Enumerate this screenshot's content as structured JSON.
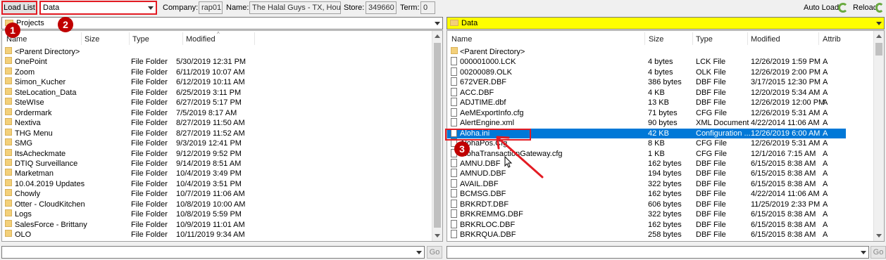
{
  "toolbar": {
    "load_list": "Load List",
    "list_select": "Data",
    "company_label": "Company:",
    "company_value": "rap01",
    "name_label": "Name:",
    "name_value": "The Halal Guys - TX, Housto",
    "store_label": "Store:",
    "store_value": "349660",
    "term_label": "Term:",
    "term_value": "0",
    "auto_load": "Auto Load",
    "reload": "Reload"
  },
  "left": {
    "path": "Projects",
    "columns": {
      "name": "Name",
      "size": "Size",
      "type": "Type",
      "modified": "Modified"
    },
    "rows": [
      {
        "name": "<Parent Directory>",
        "size": "",
        "type": "",
        "modified": ""
      },
      {
        "name": "OnePoint",
        "size": "",
        "type": "File Folder",
        "modified": "5/30/2019 12:31 PM"
      },
      {
        "name": "Zoom",
        "size": "",
        "type": "File Folder",
        "modified": "6/11/2019 10:07 AM"
      },
      {
        "name": "Simon_Kucher",
        "size": "",
        "type": "File Folder",
        "modified": "6/12/2019 10:11 AM"
      },
      {
        "name": "SteLocation_Data",
        "size": "",
        "type": "File Folder",
        "modified": "6/25/2019 3:11 PM"
      },
      {
        "name": "SteWIse",
        "size": "",
        "type": "File Folder",
        "modified": "6/27/2019 5:17 PM"
      },
      {
        "name": "Ordermark",
        "size": "",
        "type": "File Folder",
        "modified": "7/5/2019 8:17 AM"
      },
      {
        "name": "Nextiva",
        "size": "",
        "type": "File Folder",
        "modified": "8/27/2019 11:50 AM"
      },
      {
        "name": "THG Menu",
        "size": "",
        "type": "File Folder",
        "modified": "8/27/2019 11:52 AM"
      },
      {
        "name": "SMG",
        "size": "",
        "type": "File Folder",
        "modified": "9/3/2019 12:41 PM"
      },
      {
        "name": "ItsAcheckmate",
        "size": "",
        "type": "File Folder",
        "modified": "9/12/2019 9:52 PM"
      },
      {
        "name": "DTIQ Surveillance",
        "size": "",
        "type": "File Folder",
        "modified": "9/14/2019 8:51 AM"
      },
      {
        "name": "Marketman",
        "size": "",
        "type": "File Folder",
        "modified": "10/4/2019 3:49 PM"
      },
      {
        "name": "10.04.2019 Updates",
        "size": "",
        "type": "File Folder",
        "modified": "10/4/2019 3:51 PM"
      },
      {
        "name": "Chowly",
        "size": "",
        "type": "File Folder",
        "modified": "10/7/2019 11:06 AM"
      },
      {
        "name": "Otter - CloudKitchen",
        "size": "",
        "type": "File Folder",
        "modified": "10/8/2019 10:00 AM"
      },
      {
        "name": "Logs",
        "size": "",
        "type": "File Folder",
        "modified": "10/8/2019 5:59 PM"
      },
      {
        "name": "SalesForce - Brittany",
        "size": "",
        "type": "File Folder",
        "modified": "10/9/2019 11:01 AM"
      },
      {
        "name": "OLO",
        "size": "",
        "type": "File Folder",
        "modified": "10/11/2019 9:34 AM"
      }
    ],
    "go": "Go"
  },
  "right": {
    "path": "Data",
    "columns": {
      "name": "Name",
      "size": "Size",
      "type": "Type",
      "modified": "Modified",
      "attrib": "Attrib"
    },
    "rows": [
      {
        "name": "<Parent Directory>",
        "size": "",
        "type": "",
        "modified": "",
        "attrib": "",
        "folder": true
      },
      {
        "name": "000001000.LCK",
        "size": "4 bytes",
        "type": "LCK File",
        "modified": "12/26/2019 1:59 PM",
        "attrib": "A"
      },
      {
        "name": "00200089.OLK",
        "size": "4 bytes",
        "type": "OLK File",
        "modified": "12/26/2019 2:00 PM",
        "attrib": "A"
      },
      {
        "name": "672VER.DBF",
        "size": "386 bytes",
        "type": "DBF File",
        "modified": "3/17/2015 12:30 PM",
        "attrib": "A"
      },
      {
        "name": "ACC.DBF",
        "size": "4 KB",
        "type": "DBF File",
        "modified": "12/20/2019 5:34 AM",
        "attrib": "A"
      },
      {
        "name": "ADJTIME.dbf",
        "size": "13 KB",
        "type": "DBF File",
        "modified": "12/26/2019 12:00 PM",
        "attrib": "A"
      },
      {
        "name": "AeMExportInfo.cfg",
        "size": "71 bytes",
        "type": "CFG File",
        "modified": "12/26/2019 5:31 AM",
        "attrib": "A"
      },
      {
        "name": "AlertEngine.xml",
        "size": "90 bytes",
        "type": "XML Document",
        "modified": "4/22/2014 11:06 AM",
        "attrib": "A"
      },
      {
        "name": "Aloha.ini",
        "size": "42 KB",
        "type": "Configuration ...",
        "modified": "12/26/2019 6:00 AM",
        "attrib": "A",
        "selected": true
      },
      {
        "name": "AlohaPos.Cfg",
        "size": "8 KB",
        "type": "CFG File",
        "modified": "12/26/2019 5:31 AM",
        "attrib": "A"
      },
      {
        "name": "AlohaTransactionGateway.cfg",
        "size": "1 KB",
        "type": "CFG File",
        "modified": "12/1/2016 7:15 AM",
        "attrib": "A"
      },
      {
        "name": "AMNU.DBF",
        "size": "162 bytes",
        "type": "DBF File",
        "modified": "6/15/2015 8:38 AM",
        "attrib": "A"
      },
      {
        "name": "AMNUD.DBF",
        "size": "194 bytes",
        "type": "DBF File",
        "modified": "6/15/2015 8:38 AM",
        "attrib": "A"
      },
      {
        "name": "AVAIL.DBF",
        "size": "322 bytes",
        "type": "DBF File",
        "modified": "6/15/2015 8:38 AM",
        "attrib": "A"
      },
      {
        "name": "BCMSG.DBF",
        "size": "162 bytes",
        "type": "DBF File",
        "modified": "4/22/2014 11:06 AM",
        "attrib": "A"
      },
      {
        "name": "BRKRDT.DBF",
        "size": "606 bytes",
        "type": "DBF File",
        "modified": "11/25/2019 2:33 PM",
        "attrib": "A"
      },
      {
        "name": "BRKREMMG.DBF",
        "size": "322 bytes",
        "type": "DBF File",
        "modified": "6/15/2015 8:38 AM",
        "attrib": "A"
      },
      {
        "name": "BRKRLOC.DBF",
        "size": "162 bytes",
        "type": "DBF File",
        "modified": "6/15/2015 8:38 AM",
        "attrib": "A"
      },
      {
        "name": "BRKRQUA.DBF",
        "size": "258 bytes",
        "type": "DBF File",
        "modified": "6/15/2015 8:38 AM",
        "attrib": "A"
      }
    ],
    "go": "Go"
  },
  "annotations": {
    "m1": "1",
    "m2": "2",
    "m3": "3"
  },
  "colors": {
    "highlight": "#0078d7",
    "path_bar": "#ffff00",
    "annotation": "#e31b23"
  }
}
